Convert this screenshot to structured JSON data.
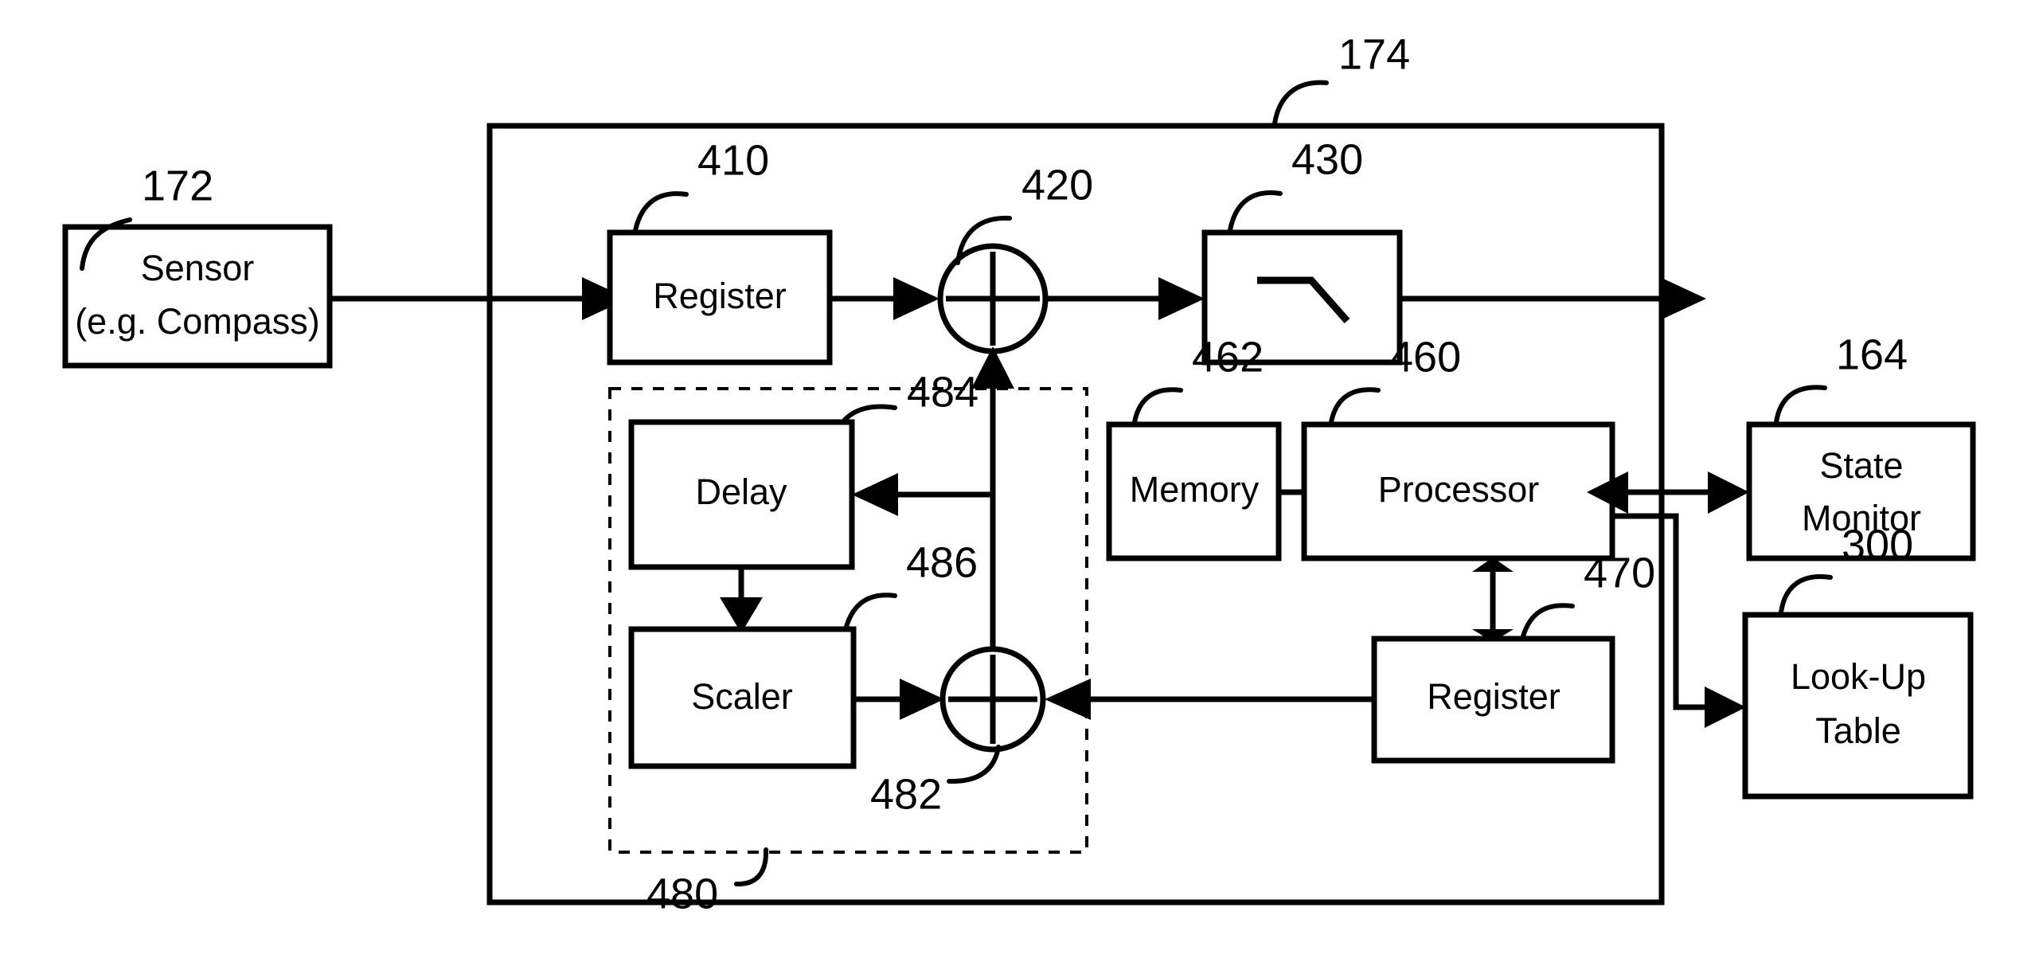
{
  "figure": {
    "type": "patent-block-diagram",
    "background": "#ffffff",
    "line_color": "#000000"
  },
  "blocks": {
    "sensor": {
      "label_line1": "Sensor",
      "label_line2": "(e.g. Compass)",
      "ref": "172"
    },
    "register_410": {
      "label": "Register",
      "ref": "410"
    },
    "adder_420": {
      "label": "+",
      "ref": "420"
    },
    "filter_430": {
      "label": "",
      "ref": "430",
      "icon": "low-pass-filter-symbol"
    },
    "delay_484": {
      "label": "Delay",
      "ref": "484"
    },
    "scaler_486": {
      "label": "Scaler",
      "ref": "486"
    },
    "adder_482": {
      "label": "+",
      "ref": "482"
    },
    "feedback_group_480": {
      "ref": "480"
    },
    "memory_462": {
      "label": "Memory",
      "ref": "462"
    },
    "processor_460": {
      "label": "Processor",
      "ref": "460"
    },
    "register_470": {
      "label": "Register",
      "ref": "470"
    },
    "state_monitor_164": {
      "label_line1": "State",
      "label_line2": "Monitor",
      "ref": "164"
    },
    "lookup_table_300": {
      "label_line1": "Look-Up",
      "label_line2": "Table",
      "ref": "300"
    },
    "outer_module_174": {
      "ref": "174"
    }
  },
  "refs": {
    "r172": "172",
    "r174": "174",
    "r410": "410",
    "r420": "420",
    "r430": "430",
    "r460": "460",
    "r462": "462",
    "r470": "470",
    "r480": "480",
    "r482": "482",
    "r484": "484",
    "r486": "486",
    "r164": "164",
    "r300": "300"
  }
}
